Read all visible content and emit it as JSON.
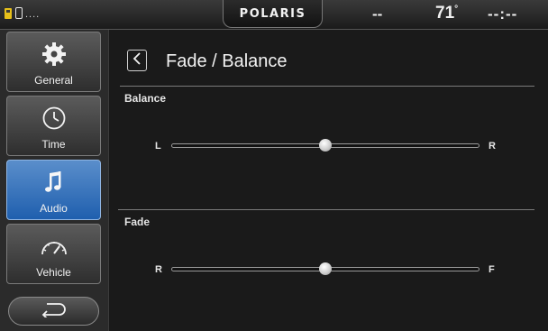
{
  "status_bar": {
    "signal_text": "....",
    "logo": "POLARIS",
    "status_dash": "--",
    "temperature": "71",
    "temperature_unit": "°",
    "clock": "--:--"
  },
  "sidebar": {
    "items": [
      {
        "label": "General",
        "icon": "gear-icon",
        "active": false
      },
      {
        "label": "Time",
        "icon": "clock-icon",
        "active": false
      },
      {
        "label": "Audio",
        "icon": "music-note-icon",
        "active": true
      },
      {
        "label": "Vehicle",
        "icon": "speedometer-icon",
        "active": false
      }
    ],
    "back_icon": "return-arrow-icon"
  },
  "main": {
    "title": "Fade / Balance",
    "back_icon": "chevron-left-icon",
    "balance": {
      "title": "Balance",
      "left_label": "L",
      "right_label": "R",
      "value": 0.5
    },
    "fade": {
      "title": "Fade",
      "left_label": "R",
      "right_label": "F",
      "value": 0.5
    }
  },
  "colors": {
    "accent_active": "#2f6fbe",
    "fuel_icon": "#e7c01a",
    "background": "#1a1a1a"
  }
}
